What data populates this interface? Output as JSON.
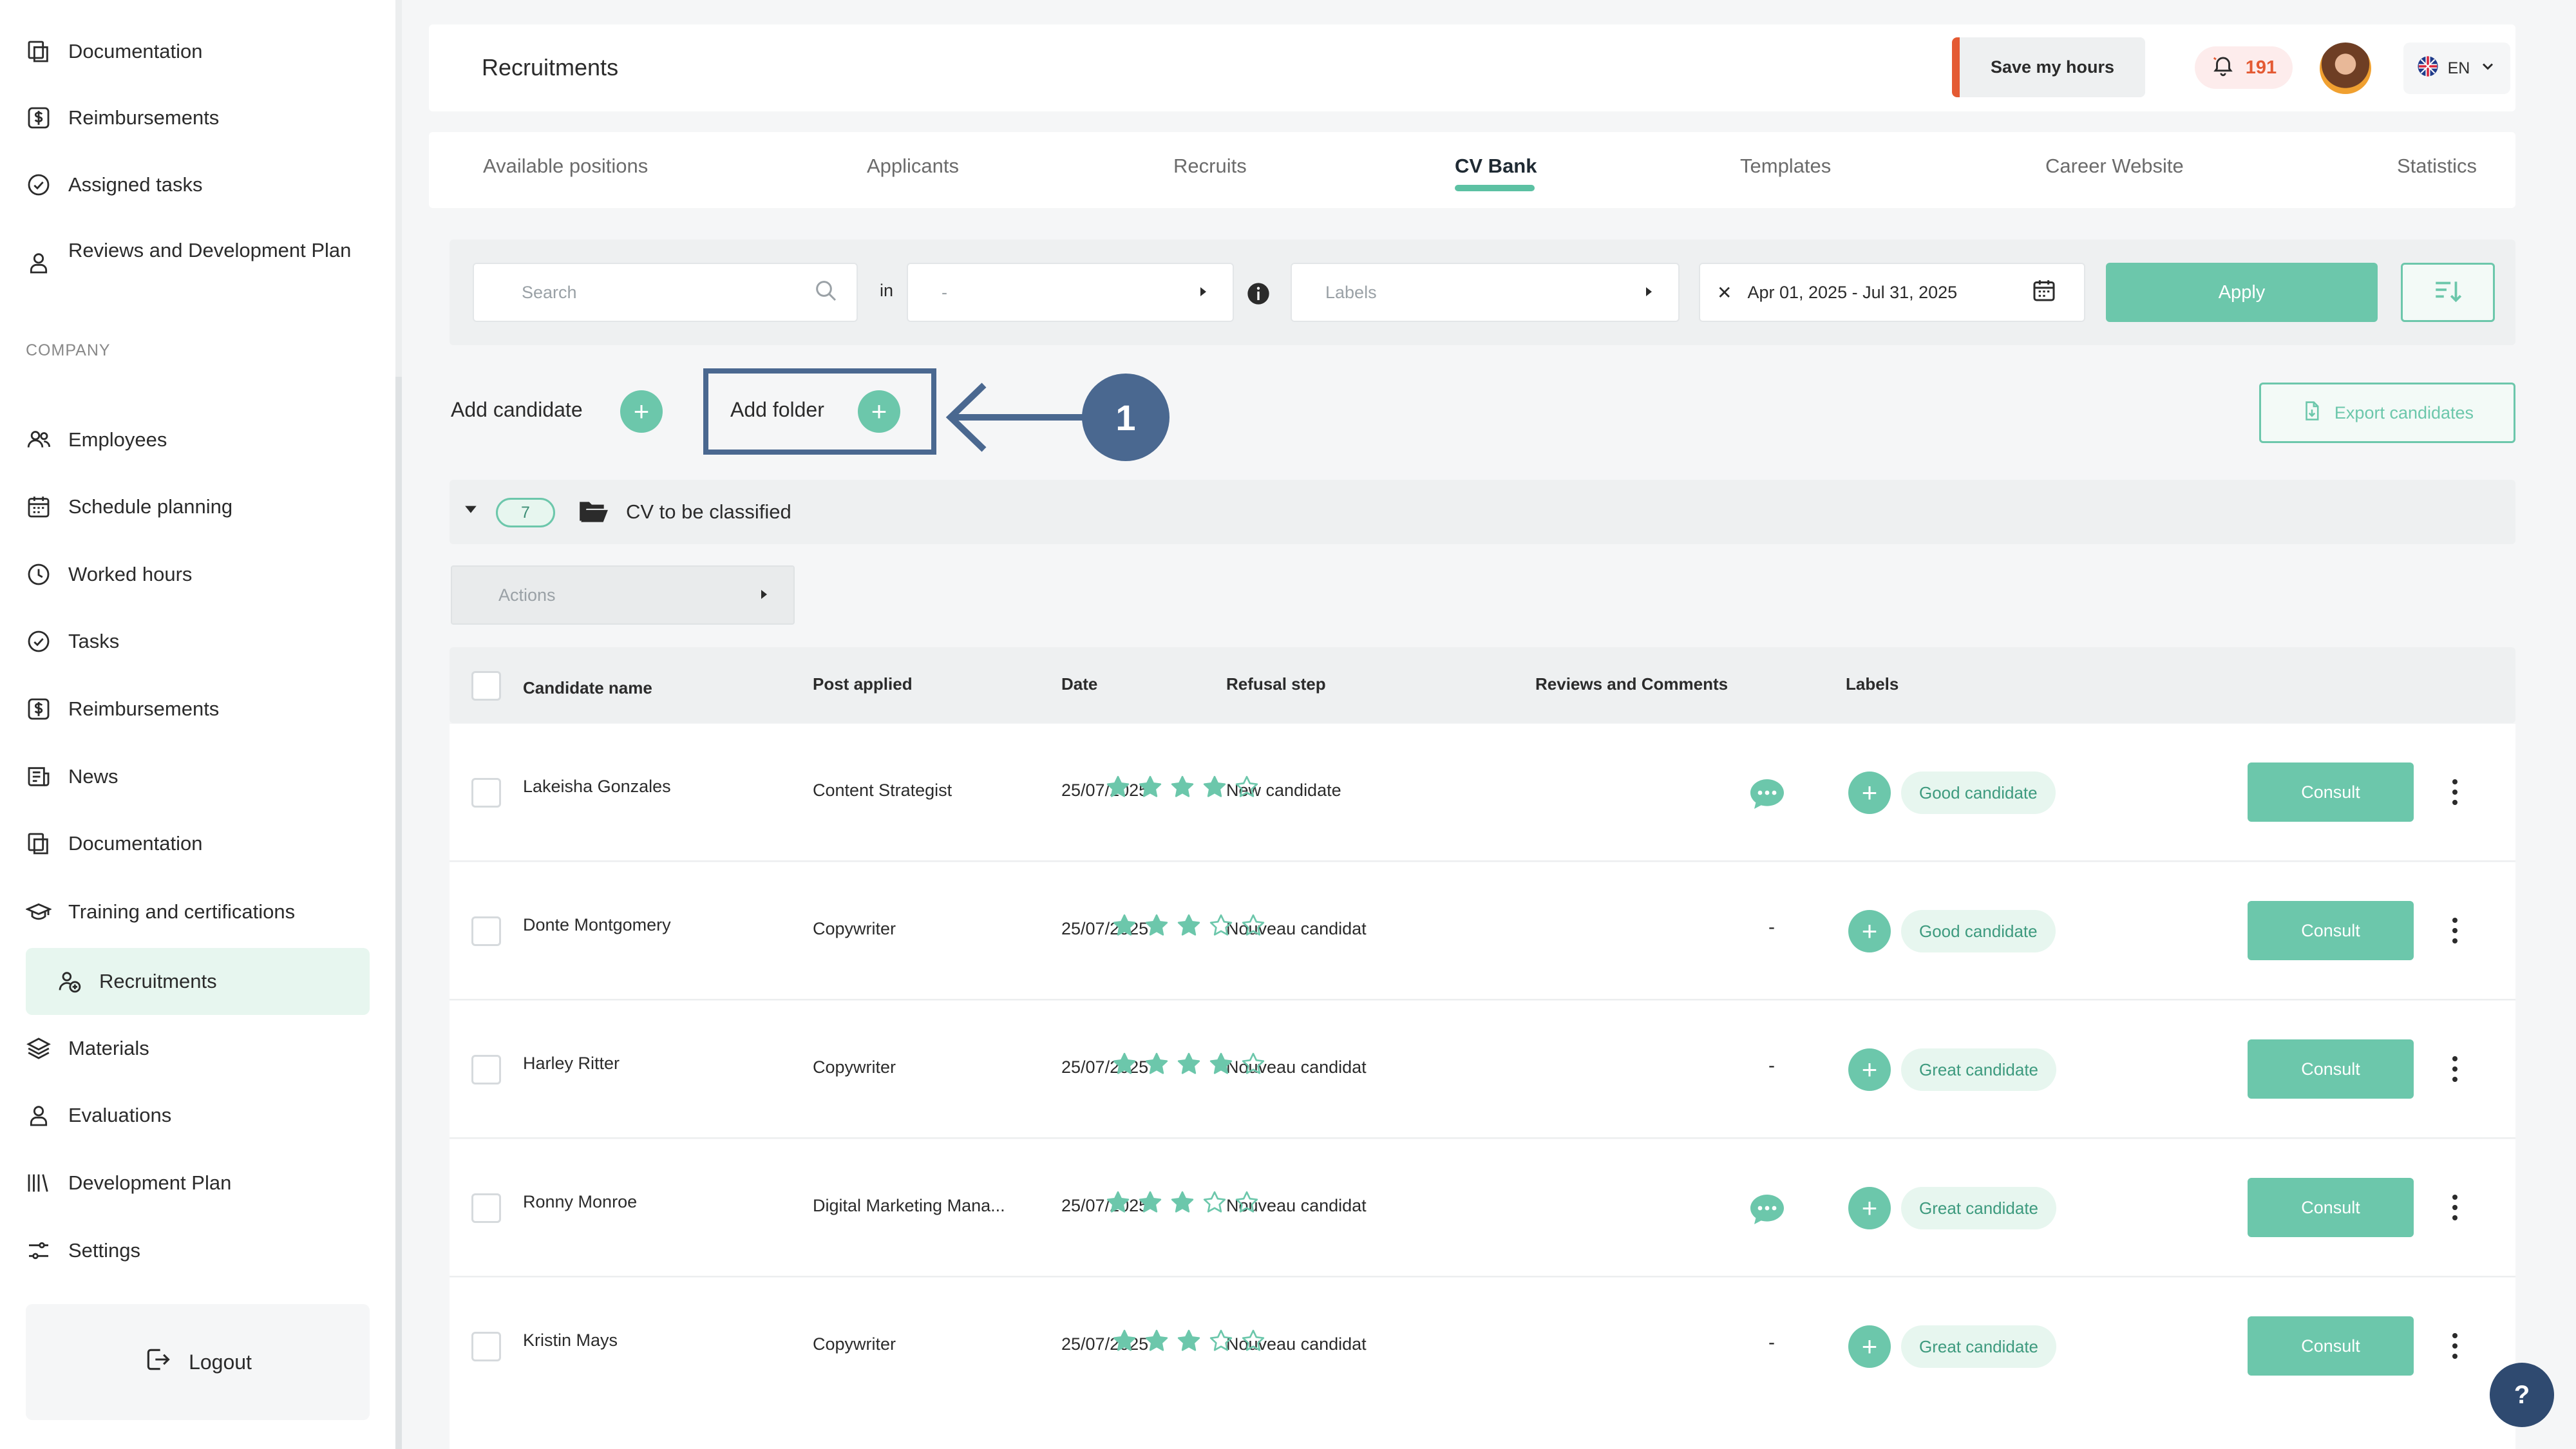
{
  "sidebar": {
    "top_items": [
      {
        "label": "Documentation",
        "icon": "documents-icon"
      },
      {
        "label": "Reimbursements",
        "icon": "dollar-icon"
      },
      {
        "label": "Assigned tasks",
        "icon": "check-circle-icon"
      },
      {
        "label": "Reviews and Development Plan",
        "icon": "person-icon"
      }
    ],
    "section_title": "COMPANY",
    "company_items": [
      {
        "label": "Employees",
        "icon": "users-icon"
      },
      {
        "label": "Schedule planning",
        "icon": "calendar-icon"
      },
      {
        "label": "Worked hours",
        "icon": "clock-icon"
      },
      {
        "label": "Tasks",
        "icon": "check-circle-icon"
      },
      {
        "label": "Reimbursements",
        "icon": "dollar-icon"
      },
      {
        "label": "News",
        "icon": "news-icon"
      },
      {
        "label": "Documentation",
        "icon": "documents-icon"
      },
      {
        "label": "Training and certifications",
        "icon": "graduation-cap-icon"
      },
      {
        "label": "Recruitments",
        "icon": "recruit-icon",
        "active": true
      },
      {
        "label": "Materials",
        "icon": "layers-icon"
      },
      {
        "label": "Evaluations",
        "icon": "person-icon"
      },
      {
        "label": "Development Plan",
        "icon": "bars-icon"
      },
      {
        "label": "Settings",
        "icon": "sliders-icon"
      }
    ],
    "logout_label": "Logout"
  },
  "header": {
    "title": "Recruitments",
    "save_hours_label": "Save my hours",
    "notification_count": "191",
    "language": "EN"
  },
  "tabs": [
    {
      "label": "Available positions"
    },
    {
      "label": "Applicants"
    },
    {
      "label": "Recruits"
    },
    {
      "label": "CV Bank",
      "active": true
    },
    {
      "label": "Templates"
    },
    {
      "label": "Career Website"
    },
    {
      "label": "Statistics"
    }
  ],
  "filters": {
    "search_placeholder": "Search",
    "in_label": "in",
    "in_value": "-",
    "labels_placeholder": "Labels",
    "date_range": "Apr 01, 2025 - Jul 31, 2025",
    "apply_label": "Apply"
  },
  "toolbar": {
    "add_candidate_label": "Add candidate",
    "add_folder_label": "Add folder",
    "marker_number": "1",
    "export_label": "Export candidates"
  },
  "folder": {
    "count": "7",
    "name": "CV to be classified"
  },
  "actions_label": "Actions",
  "table": {
    "headers": [
      "Candidate name",
      "Post applied",
      "Date",
      "Refusal step",
      "Reviews and Comments",
      "Labels"
    ],
    "consult_label": "Consult",
    "rows": [
      {
        "name": "Lakeisha Gonzales",
        "post": "Content Strategist",
        "date": "25/07/2025",
        "step": "New candidate",
        "rating": 4,
        "comment": true,
        "label": "Good candidate"
      },
      {
        "name": "Donte Montgomery",
        "post": "Copywriter",
        "date": "25/07/2025",
        "step": "Nouveau candidat",
        "rating": 3,
        "comment": false,
        "label": "Good candidate"
      },
      {
        "name": "Harley Ritter",
        "post": "Copywriter",
        "date": "25/07/2025",
        "step": "Nouveau candidat",
        "rating": 4,
        "comment": false,
        "label": "Great candidate"
      },
      {
        "name": "Ronny Monroe",
        "post": "Digital Marketing Mana...",
        "date": "25/07/2025",
        "step": "Nouveau candidat",
        "rating": 3,
        "comment": true,
        "label": "Great candidate"
      },
      {
        "name": "Kristin Mays",
        "post": "Copywriter",
        "date": "25/07/2025",
        "step": "Nouveau candidat",
        "rating": 3,
        "comment": false,
        "label": "Great candidate"
      }
    ],
    "no_comment_text": "-"
  },
  "help_label": "?",
  "colors": {
    "accent": "#6cc7ab",
    "marker": "#4a6890",
    "warning": "#e45a33"
  }
}
